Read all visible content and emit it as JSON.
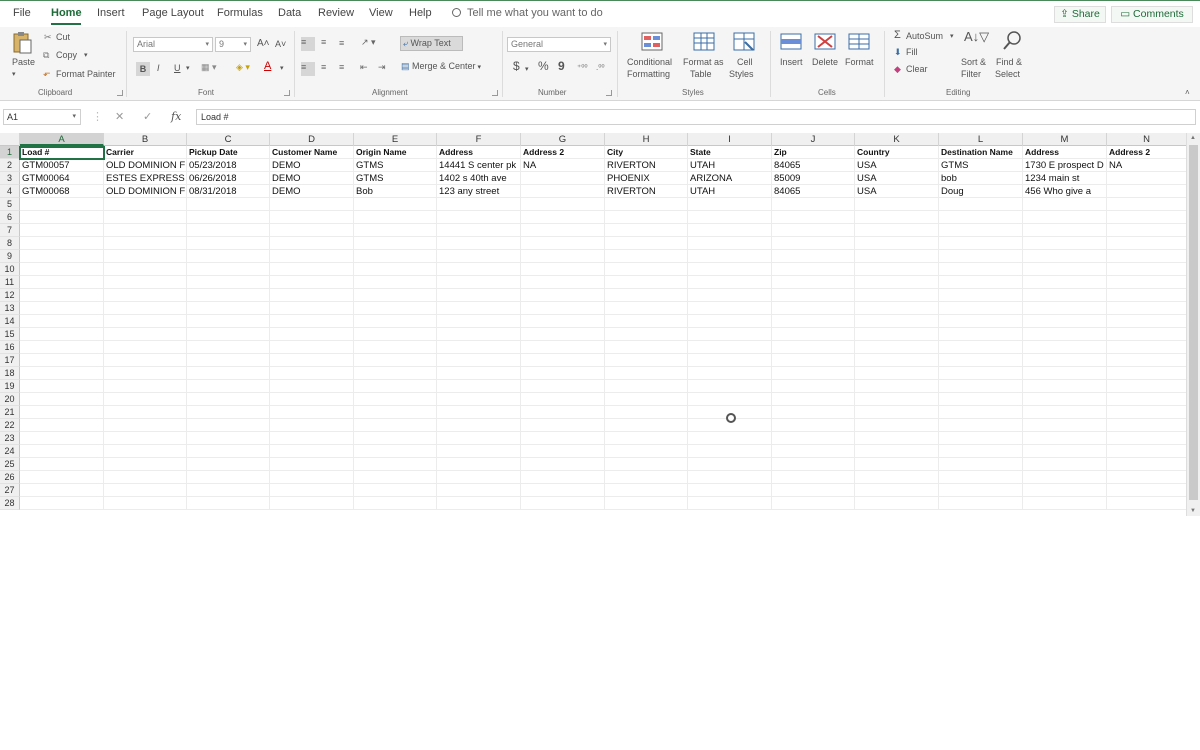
{
  "tabs": [
    {
      "label": "File"
    },
    {
      "label": "Home"
    },
    {
      "label": "Insert"
    },
    {
      "label": "Page Layout"
    },
    {
      "label": "Formulas"
    },
    {
      "label": "Data"
    },
    {
      "label": "Review"
    },
    {
      "label": "View"
    },
    {
      "label": "Help"
    }
  ],
  "tell_me": "Tell me what you want to do",
  "share_label": "Share",
  "comments_label": "Comments",
  "ribbon": {
    "clipboard": {
      "paste": "Paste",
      "cut": "Cut",
      "copy": "Copy",
      "format_painter": "Format Painter",
      "label": "Clipboard"
    },
    "font": {
      "name": "Arial",
      "size": "9",
      "bold": "B",
      "italic": "I",
      "underline": "U",
      "label": "Font"
    },
    "alignment": {
      "wrap_text": "Wrap Text",
      "merge_center": "Merge & Center",
      "label": "Alignment"
    },
    "number": {
      "format": "General",
      "currency": "$",
      "percent": "%",
      "comma": "9",
      "label": "Number"
    },
    "styles": {
      "conditional": "Conditional",
      "conditional2": "Formatting",
      "format_as": "Format as",
      "format_as2": "Table",
      "cell_styles": "Cell",
      "cell_styles2": "Styles",
      "label": "Styles"
    },
    "cells": {
      "insert": "Insert",
      "delete": "Delete",
      "format": "Format",
      "label": "Cells"
    },
    "editing": {
      "autosum": "AutoSum",
      "fill": "Fill",
      "clear": "Clear",
      "sort": "Sort &",
      "sort2": "Filter",
      "find": "Find &",
      "find2": "Select",
      "label": "Editing"
    }
  },
  "formula_bar": {
    "name_box": "A1",
    "fx": "fx",
    "content": "Load #"
  },
  "columns": [
    "A",
    "B",
    "C",
    "D",
    "E",
    "F",
    "G",
    "H",
    "I",
    "J",
    "K",
    "L",
    "M",
    "N"
  ],
  "rows": [
    [
      "Load #",
      "Carrier",
      "Pickup Date",
      "Customer Name",
      "Origin Name",
      "Address",
      "Address 2",
      "City",
      "State",
      "Zip",
      "Country",
      "Destination Name",
      "Address",
      "Address 2"
    ],
    [
      "GTM00057",
      "OLD DOMINION F",
      "05/23/2018",
      "DEMO",
      "GTMS",
      "14441 S center pk",
      "NA",
      "RIVERTON",
      "UTAH",
      "84065",
      "USA",
      "GTMS",
      "1730 E prospect D",
      "NA"
    ],
    [
      "GTM00064",
      "ESTES EXPRESS",
      "06/26/2018",
      "DEMO",
      "GTMS",
      "1402 s 40th ave",
      "",
      "PHOENIX",
      "ARIZONA",
      "85009",
      "USA",
      "bob",
      "1234 main st",
      ""
    ],
    [
      "GTM00068",
      "OLD DOMINION F",
      "08/31/2018",
      "DEMO",
      "Bob",
      "123 any street",
      "",
      "RIVERTON",
      "UTAH",
      "84065",
      "USA",
      "Doug",
      "456 Who give a",
      ""
    ]
  ],
  "row_numbers": [
    "1",
    "2",
    "3",
    "4",
    "5",
    "6",
    "7",
    "8",
    "9",
    "10",
    "11",
    "12",
    "13",
    "14",
    "15",
    "16",
    "17",
    "18",
    "19",
    "20",
    "21",
    "22",
    "23",
    "24",
    "25",
    "26",
    "27",
    "28"
  ]
}
